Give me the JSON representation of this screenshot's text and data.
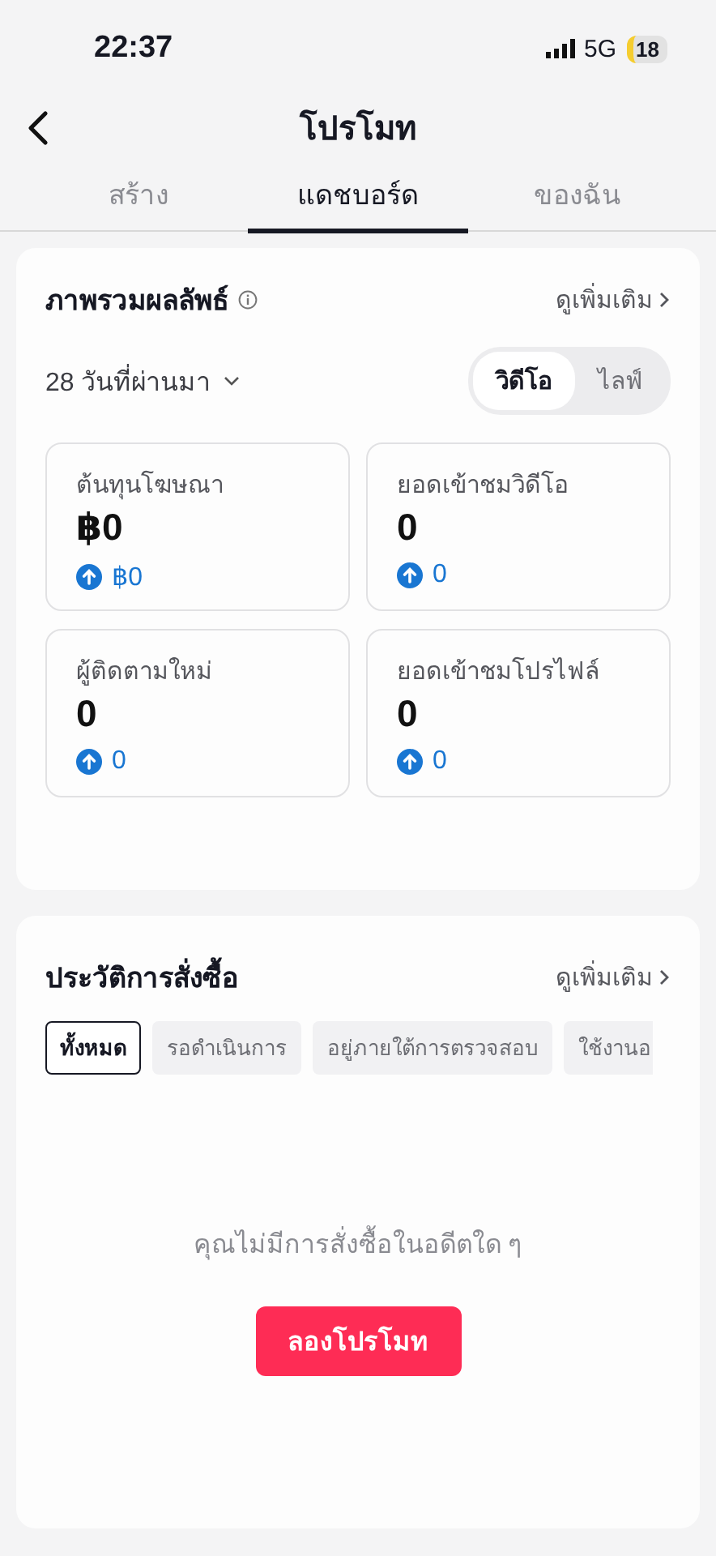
{
  "status_bar": {
    "time": "22:37",
    "network": "5G",
    "battery": "18"
  },
  "header": {
    "title": "โปรโมท"
  },
  "tabs": [
    {
      "label": "สร้าง",
      "selected": false
    },
    {
      "label": "แดชบอร์ด",
      "selected": true
    },
    {
      "label": "ของฉัน",
      "selected": false
    }
  ],
  "overview": {
    "title": "ภาพรวมผลลัพธ์",
    "more_link": "ดูเพิ่มเติม",
    "period": "28 วันที่ผ่านมา",
    "toggle": [
      {
        "label": "วิดีโอ",
        "selected": true
      },
      {
        "label": "ไลฟ์",
        "selected": false
      }
    ],
    "metrics": [
      {
        "label": "ต้นทุนโฆษณา",
        "value": "฿0",
        "change": "฿0"
      },
      {
        "label": "ยอดเข้าชมวิดีโอ",
        "value": "0",
        "change": "0"
      },
      {
        "label": "ผู้ติดตามใหม่",
        "value": "0",
        "change": "0"
      },
      {
        "label": "ยอดเข้าชมโปรไฟล์",
        "value": "0",
        "change": "0"
      }
    ]
  },
  "orders": {
    "title": "ประวัติการสั่งซื้อ",
    "more_link": "ดูเพิ่มเติม",
    "filters": [
      {
        "label": "ทั้งหมด",
        "selected": true
      },
      {
        "label": "รอดำเนินการ",
        "selected": false
      },
      {
        "label": "อยู่ภายใต้การตรวจสอบ",
        "selected": false
      },
      {
        "label": "ใช้งานอ",
        "selected": false
      }
    ],
    "empty_text": "คุณไม่มีการสั่งซื้อในอดีตใด ๆ",
    "button": "ลองโปรโมท"
  }
}
